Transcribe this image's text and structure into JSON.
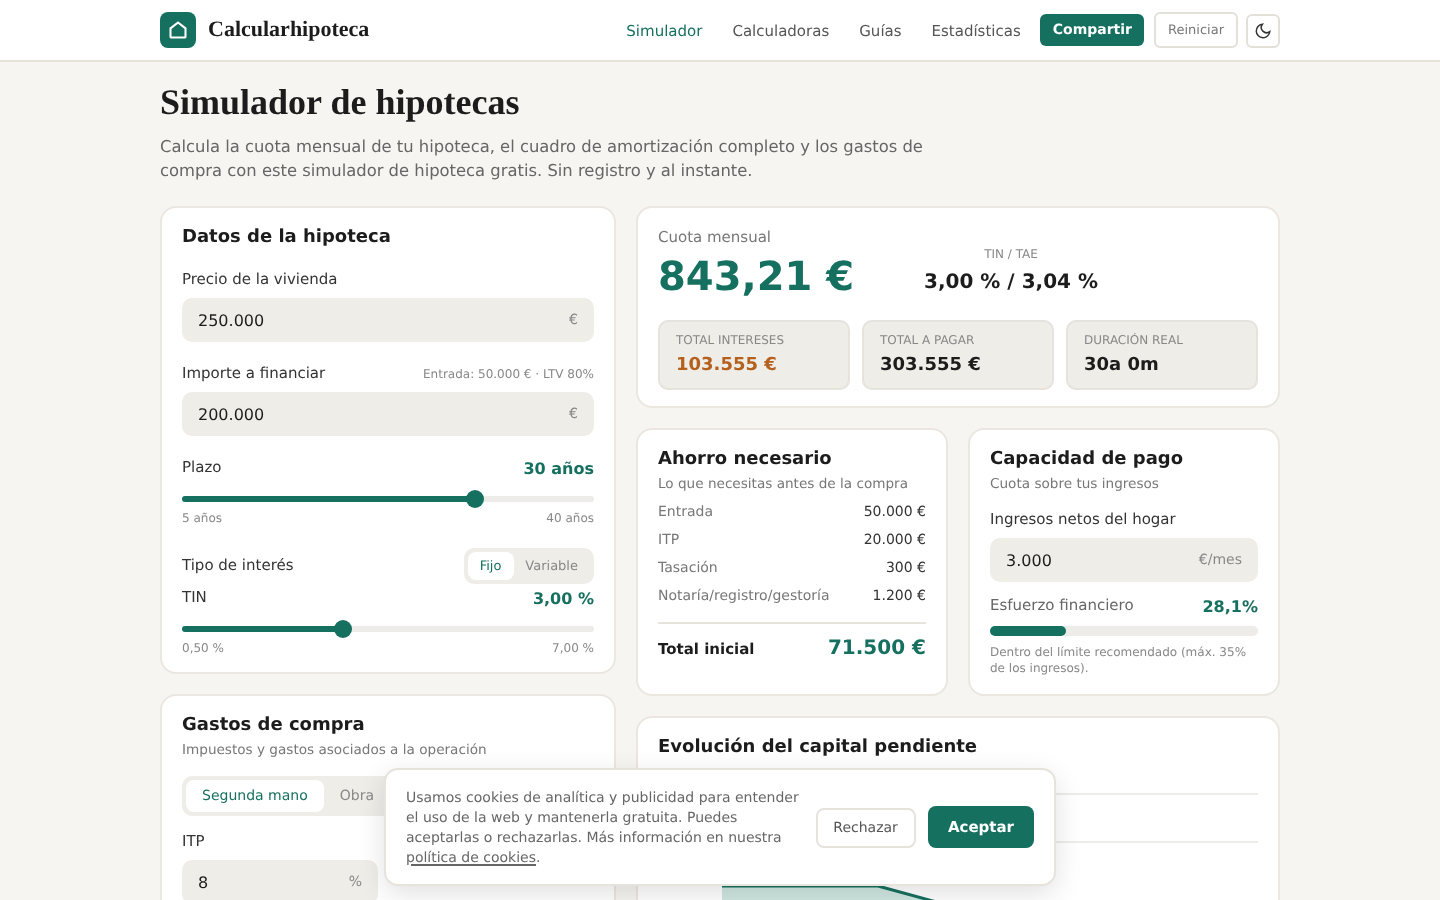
{
  "header": {
    "brand": "Calcularhipoteca",
    "nav": [
      {
        "label": "Simulador",
        "selected": true
      },
      {
        "label": "Calculadoras",
        "selected": false
      },
      {
        "label": "Guías",
        "selected": false
      },
      {
        "label": "Estadísticas",
        "selected": false
      }
    ],
    "share_button": "Compartir",
    "reset_button": "Reiniciar"
  },
  "intro": {
    "title": "Simulador de hipotecas",
    "text": "Calcula la cuota mensual de tu hipoteca, el cuadro de amortización completo y los gastos de compra con este simulador de hipoteca gratis. Sin registro y al instante."
  },
  "mortgage": {
    "title": "Datos de la hipoteca",
    "price": {
      "label": "Precio de la vivienda",
      "value": "250.000",
      "unit": "€"
    },
    "loan": {
      "label": "Importe a financiar",
      "hint": "Entrada: 50.000 € · LTV 80%",
      "value": "200.000",
      "unit": "€"
    },
    "term": {
      "label": "Plazo",
      "reading": "30 años",
      "level": 0.71,
      "min": "5 años",
      "max": "40 años"
    },
    "rate_type": {
      "label": "Tipo de interés",
      "options": [
        {
          "label": "Fijo",
          "selected": true
        },
        {
          "label": "Variable",
          "selected": false
        }
      ]
    },
    "tin": {
      "label": "TIN",
      "reading": "3,00 %",
      "level": 0.39,
      "min": "0,50 %",
      "max": "7,00 %"
    }
  },
  "summary": {
    "label": "Cuota mensual",
    "value": "843,21 €",
    "rate_label": "TIN / TAE",
    "rate_value": "3,00 % / 3,04 %",
    "stats": [
      {
        "label": "TOTAL INTERESES",
        "value": "103.555 €",
        "color": "#b5601c"
      },
      {
        "label": "TOTAL A PAGAR",
        "value": "303.555 €",
        "color": "#1c1c1c"
      },
      {
        "label": "DURACIÓN REAL",
        "value": "30a 0m",
        "color": "#1c1c1c"
      }
    ]
  },
  "savings": {
    "title": "Ahorro necesario",
    "subtitle": "Lo que necesitas antes de la compra",
    "rows": [
      {
        "label": "Entrada",
        "value": "50.000 €"
      },
      {
        "label": "ITP",
        "value": "20.000 €"
      },
      {
        "label": "Tasación",
        "value": "300 €"
      },
      {
        "label": "Notaría/registro/gestoría",
        "value": "1.200 €"
      }
    ],
    "total_label": "Total inicial",
    "total_value": "71.500 €"
  },
  "capacity": {
    "title": "Capacidad de pago",
    "subtitle": "Cuota sobre tus ingresos",
    "income_label": "Ingresos netos del hogar",
    "income_value": "3.000",
    "income_unit": "€/mes",
    "effort_label": "Esfuerzo financiero",
    "effort_value": "28,1%",
    "level": 0.281,
    "note": "Dentro del límite recomendado (máx. 35% de los ingresos)."
  },
  "costs": {
    "title": "Gastos de compra",
    "subtitle": "Impuestos y gastos asociados a la operación",
    "tabs": [
      {
        "label": "Segunda mano",
        "selected": true
      },
      {
        "label": "Obra",
        "selected": false
      }
    ],
    "itp_label": "ITP",
    "itp_value": "8",
    "itp_unit": "%"
  },
  "chart": {
    "title": "Evolución del capital pendiente"
  },
  "cookie": {
    "text": "Usamos cookies de analítica y publicidad para entender el uso de la web y mantenerla gratuita. Puedes aceptarlas o rechazarlas. Más información en nuestra ",
    "link": "política de cookies",
    "end": ".",
    "reject": "Rechazar",
    "accept": "Aceptar"
  }
}
